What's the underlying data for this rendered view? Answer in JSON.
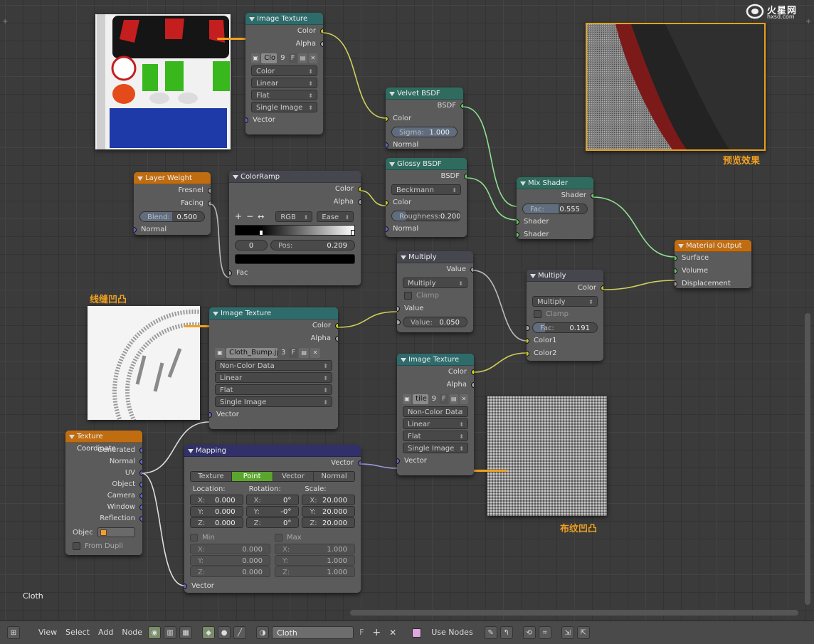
{
  "watermark": "hxsd.com",
  "watermark_brand": "火星网",
  "labels": {
    "preview": "预览效果",
    "stitch_bump": "线缝凹凸",
    "cloth_bump": "布纹凹凸",
    "material_name_corner": "Cloth"
  },
  "nodes": {
    "image_texture_1": {
      "title": "Image Texture",
      "outputs": [
        "Color",
        "Alpha"
      ],
      "image_name": "Clo",
      "users": "9",
      "fake": "F",
      "color_space": "Color",
      "interpolation": "Linear",
      "projection": "Flat",
      "source": "Single Image",
      "input": "Vector"
    },
    "velvet": {
      "title": "Velvet BSDF",
      "output": "BSDF",
      "in_color": "Color",
      "sigma_label": "Sigma:",
      "sigma_value": "1.000",
      "in_normal": "Normal"
    },
    "layer_weight": {
      "title": "Layer Weight",
      "out_fresnel": "Fresnel",
      "out_facing": "Facing",
      "blend_label": "Blend:",
      "blend_value": "0.500",
      "in_normal": "Normal"
    },
    "colorramp": {
      "title": "ColorRamp",
      "out_color": "Color",
      "out_alpha": "Alpha",
      "plus": "+",
      "minus": "−",
      "flip": "↔",
      "mode": "RGB",
      "interp": "Ease",
      "stop_index": "0",
      "pos_label": "Pos:",
      "pos_value": "0.209",
      "in_fac": "Fac"
    },
    "glossy": {
      "title": "Glossy BSDF",
      "output": "BSDF",
      "distribution": "Beckmann",
      "in_color": "Color",
      "rough_label": "Roughness:",
      "rough_value": "0.200",
      "in_normal": "Normal"
    },
    "mix_shader": {
      "title": "Mix Shader",
      "output": "Shader",
      "fac_label": "Fac:",
      "fac_value": "0.555",
      "in_shader1": "Shader",
      "in_shader2": "Shader"
    },
    "material_output": {
      "title": "Material Output",
      "in_surface": "Surface",
      "in_volume": "Volume",
      "in_displacement": "Displacement"
    },
    "multiply_math": {
      "title": "Multiply",
      "output": "Value",
      "operation": "Multiply",
      "clamp": "Clamp",
      "in_value": "Value",
      "value_label": "Value:",
      "value_value": "0.050"
    },
    "multiply_mix": {
      "title": "Multiply",
      "output": "Color",
      "operation": "Multiply",
      "clamp": "Clamp",
      "fac_label": "Fac:",
      "fac_value": "0.191",
      "in_color1": "Color1",
      "in_color2": "Color2"
    },
    "image_texture_2": {
      "title": "Image Texture",
      "outputs": [
        "Color",
        "Alpha"
      ],
      "image_name": "Cloth_Bump.jpg",
      "users": "3",
      "fake": "F",
      "color_space": "Non-Color Data",
      "interpolation": "Linear",
      "projection": "Flat",
      "source": "Single Image",
      "input": "Vector"
    },
    "image_texture_3": {
      "title": "Image Texture",
      "outputs": [
        "Color",
        "Alpha"
      ],
      "image_name": "tile",
      "users": "9",
      "fake": "F",
      "color_space": "Non-Color Data",
      "interpolation": "Linear",
      "projection": "Flat",
      "source": "Single Image",
      "input": "Vector"
    },
    "texture_coordinate": {
      "title": "Texture Coordinate",
      "outputs": [
        "Generated",
        "Normal",
        "UV",
        "Object",
        "Camera",
        "Window",
        "Reflection"
      ],
      "object_label": "Objec",
      "from_dupli": "From Dupli"
    },
    "mapping": {
      "title": "Mapping",
      "output": "Vector",
      "tabs": [
        "Texture",
        "Point",
        "Vector",
        "Normal"
      ],
      "active_tab": "Point",
      "location_label": "Location:",
      "rotation_label": "Rotation:",
      "scale_label": "Scale:",
      "location": [
        [
          "X:",
          "0.000"
        ],
        [
          "Y:",
          "0.000"
        ],
        [
          "Z:",
          "0.000"
        ]
      ],
      "rotation": [
        [
          "X:",
          "0°"
        ],
        [
          "Y:",
          "-0°"
        ],
        [
          "Z:",
          "0°"
        ]
      ],
      "scale": [
        [
          "X:",
          "20.000"
        ],
        [
          "Y:",
          "20.000"
        ],
        [
          "Z:",
          "20.000"
        ]
      ],
      "min_label": "Min",
      "max_label": "Max",
      "min": [
        [
          "X:",
          "0.000"
        ],
        [
          "Y:",
          "0.000"
        ],
        [
          "Z:",
          "0.000"
        ]
      ],
      "max": [
        [
          "X:",
          "1.000"
        ],
        [
          "Y:",
          "1.000"
        ],
        [
          "Z:",
          "1.000"
        ]
      ],
      "input": "Vector"
    }
  },
  "header": {
    "menus": [
      "View",
      "Select",
      "Add",
      "Node"
    ],
    "material": "Cloth",
    "fake": "F",
    "use_nodes": "Use Nodes"
  },
  "colors": {
    "accent_orange": "#f0a020",
    "socket_color": "#c7c729",
    "socket_vector": "#6363c7",
    "socket_shader": "#63c763",
    "socket_gray": "#a1a1a1"
  }
}
